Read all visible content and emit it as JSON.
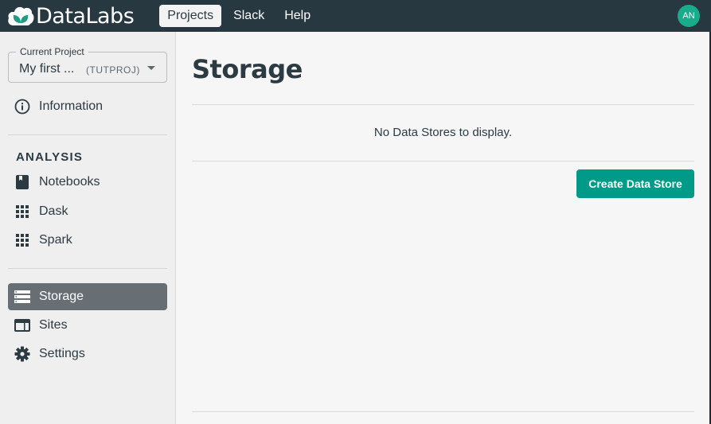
{
  "app": {
    "brand": "DataLabs",
    "colors": {
      "topbar": "#283840",
      "accent": "#009a88",
      "avatar": "#18ac8c",
      "active_nav": "#676e74"
    }
  },
  "topnav": {
    "items": [
      {
        "label": "Projects",
        "active": true
      },
      {
        "label": "Slack",
        "active": false
      },
      {
        "label": "Help",
        "active": false
      }
    ],
    "avatar_initials": "AN"
  },
  "sidebar": {
    "project_select": {
      "legend": "Current Project",
      "value": "My first ...",
      "code": "(TUTPROJ)"
    },
    "info_item": {
      "label": "Information",
      "icon": "info-icon"
    },
    "analysis_title": "ANALYSIS",
    "analysis_items": [
      {
        "label": "Notebooks",
        "icon": "notebook-icon"
      },
      {
        "label": "Dask",
        "icon": "grid-icon"
      },
      {
        "label": "Spark",
        "icon": "grid-icon"
      }
    ],
    "bottom_items": [
      {
        "label": "Storage",
        "icon": "storage-icon",
        "active": true
      },
      {
        "label": "Sites",
        "icon": "sites-icon",
        "active": false
      },
      {
        "label": "Settings",
        "icon": "gear-icon",
        "active": false
      }
    ]
  },
  "main": {
    "title": "Storage",
    "empty_message": "No Data Stores to display.",
    "create_button": "Create Data Store"
  }
}
